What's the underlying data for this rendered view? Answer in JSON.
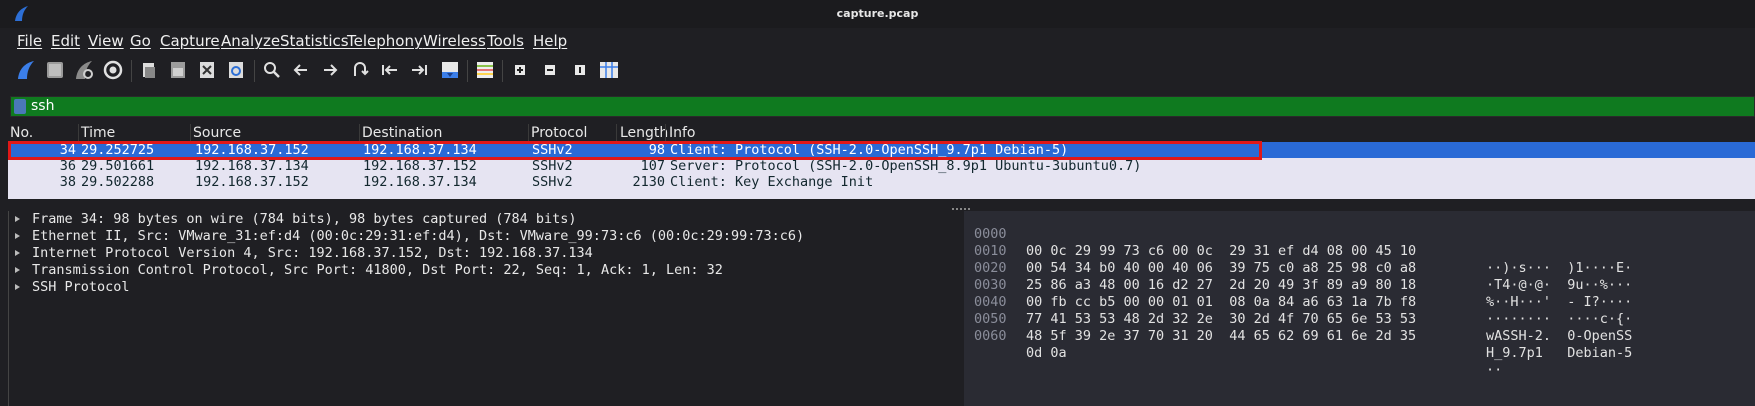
{
  "window": {
    "title": "capture.pcap"
  },
  "menu": [
    "File",
    "Edit",
    "View",
    "Go",
    "Capture",
    "Analyze",
    "Statistics",
    "Telephony",
    "Wireless",
    "Tools",
    "Help"
  ],
  "filter": {
    "value": "ssh"
  },
  "packet_list": {
    "columns": [
      "No.",
      "Time",
      "Source",
      "Destination",
      "Protocol",
      "Length",
      "Info"
    ],
    "rows": [
      {
        "no": "34",
        "time": "29.252725",
        "source": "192.168.37.152",
        "destination": "192.168.37.134",
        "protocol": "SSHv2",
        "length": "98",
        "info": "Client: Protocol (SSH-2.0-OpenSSH_9.7p1 Debian-5)",
        "selected": true
      },
      {
        "no": "36",
        "time": "29.501661",
        "source": "192.168.37.134",
        "destination": "192.168.37.152",
        "protocol": "SSHv2",
        "length": "107",
        "info": "Server: Protocol (SSH-2.0-OpenSSH_8.9p1 Ubuntu-3ubuntu0.7)",
        "selected": false
      },
      {
        "no": "38",
        "time": "29.502288",
        "source": "192.168.37.152",
        "destination": "192.168.37.134",
        "protocol": "SSHv2",
        "length": "2130",
        "info": "Client: Key Exchange Init",
        "selected": false
      }
    ]
  },
  "details": [
    "Frame 34: 98 bytes on wire (784 bits), 98 bytes captured (784 bits)",
    "Ethernet II, Src: VMware_31:ef:d4 (00:0c:29:31:ef:d4), Dst: VMware_99:73:c6 (00:0c:29:99:73:c6)",
    "Internet Protocol Version 4, Src: 192.168.37.152, Dst: 192.168.37.134",
    "Transmission Control Protocol, Src Port: 41800, Dst Port: 22, Seq: 1, Ack: 1, Len: 32",
    "SSH Protocol"
  ],
  "bytes": [
    {
      "offset": "0000",
      "hex": "00 0c 29 99 73 c6 00 0c  29 31 ef d4 08 00 45 10",
      "ascii": "··)·s···  )1····E·"
    },
    {
      "offset": "0010",
      "hex": "00 54 34 b0 40 00 40 06  39 75 c0 a8 25 98 c0 a8",
      "ascii": "·T4·@·@·  9u··%···"
    },
    {
      "offset": "0020",
      "hex": "25 86 a3 48 00 16 d2 27  2d 20 49 3f 89 a9 80 18",
      "ascii": "%··H···'  - I?····"
    },
    {
      "offset": "0030",
      "hex": "00 fb cc b5 00 00 01 01  08 0a 84 a6 63 1a 7b f8",
      "ascii": "········  ····c·{·"
    },
    {
      "offset": "0040",
      "hex": "77 41 53 53 48 2d 32 2e  30 2d 4f 70 65 6e 53 53",
      "ascii": "wASSH-2.  0-OpenSS"
    },
    {
      "offset": "0050",
      "hex": "48 5f 39 2e 37 70 31 20  44 65 62 69 61 6e 2d 35",
      "ascii": "H_9.7p1   Debian-5"
    },
    {
      "offset": "0060",
      "hex": "0d 0a",
      "ascii": "··"
    }
  ],
  "toolbar_icons": [
    "start-capture-icon",
    "stop-capture-icon",
    "restart-capture-icon",
    "capture-options-icon",
    "open-file-icon",
    "save-file-icon",
    "close-file-icon",
    "reload-file-icon",
    "find-packet-icon",
    "go-back-icon",
    "go-forward-icon",
    "go-to-packet-icon",
    "go-first-icon",
    "go-last-icon",
    "autoscroll-icon",
    "colorize-icon",
    "zoom-in-icon",
    "zoom-out-icon",
    "normal-size-icon",
    "resize-columns-icon"
  ],
  "colors": {
    "filter_valid": "#0f7a1f",
    "selected_row": "#2a6ad6",
    "highlight_box": "#e01818"
  }
}
